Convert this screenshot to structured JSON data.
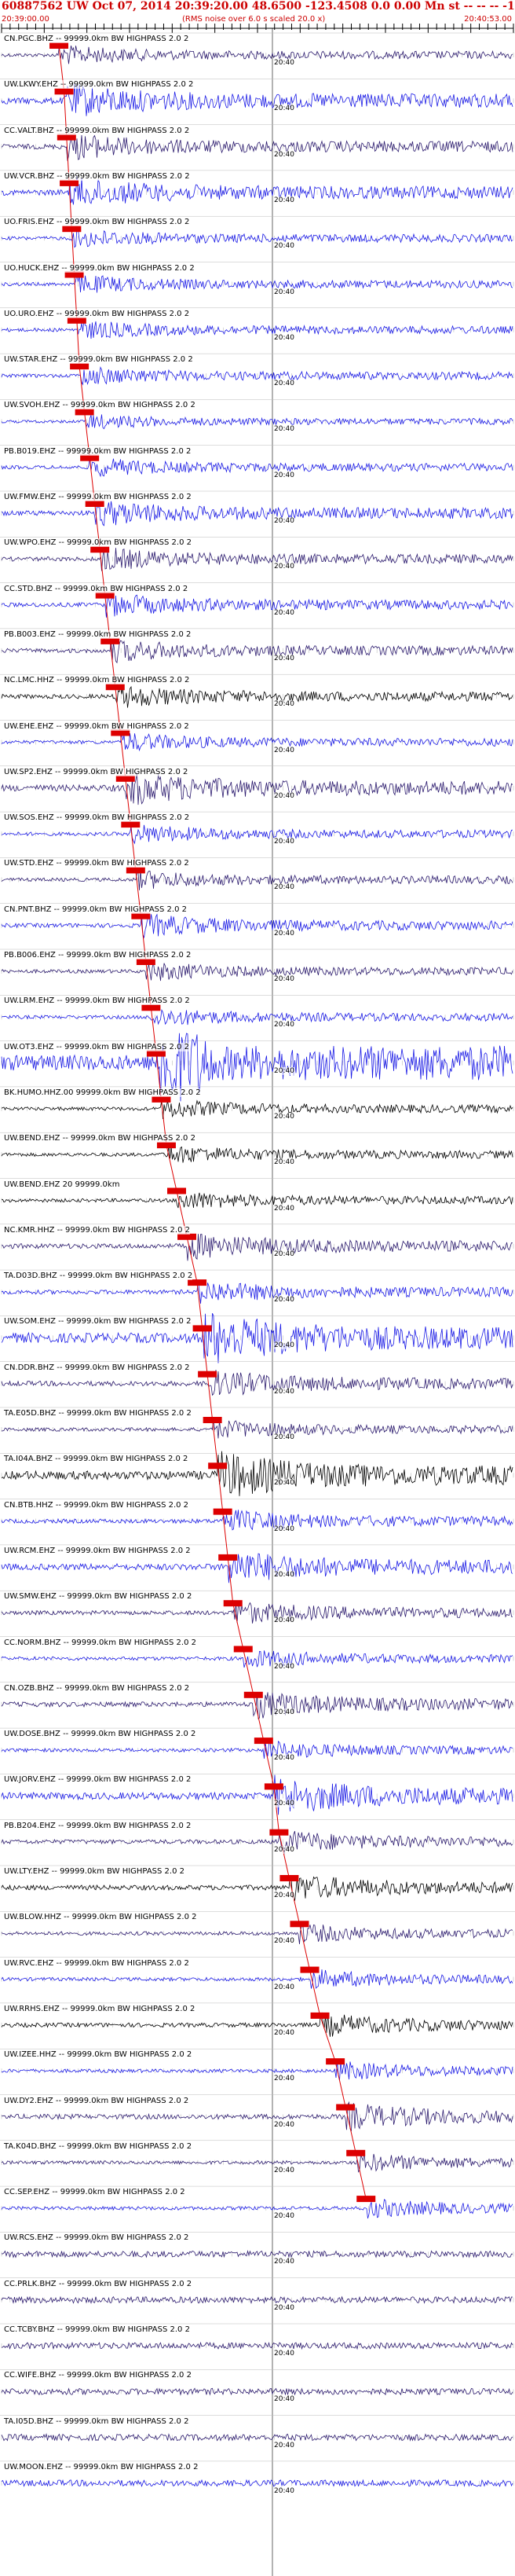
{
  "header": {
    "title": "60887562 UW Oct 07, 2014 20:39:20.00   48.6500 -123.4508  0.0 0.00 Mn st -- -- -- -1",
    "start_time": "20:39:00.00",
    "noise_note": "(RMS noise over 6.0 s scaled 20.0 x)",
    "end_time": "20:40:53.00"
  },
  "minute_mark": "20:40",
  "colors": {
    "header_text": "#cc0000",
    "pick_marker": "#dd0000",
    "trace_colors": [
      "#1a1ae6",
      "#2b1a6e",
      "#000000"
    ]
  },
  "traces": [
    {
      "label": "CN.PGC.BHZ -- 99999.0km BW  HIGHPASS  2.0  2",
      "color": "#2b1a6e",
      "amp": 5,
      "pick": 0.02
    },
    {
      "label": "UW.LKWY.EHZ -- 99999.0km BW  HIGHPASS  2.0  2",
      "color": "#1a1ae6",
      "amp": 9,
      "pick": 0.03
    },
    {
      "label": "CC.VALT.BHZ -- 99999.0km BW  HIGHPASS  2.0  2",
      "color": "#2b1a6e",
      "amp": 7,
      "pick": 0.035
    },
    {
      "label": "UW.VCR.BHZ -- 99999.0km BW  HIGHPASS  2.0  2",
      "color": "#1a1ae6",
      "amp": 8,
      "pick": 0.04
    },
    {
      "label": "UO.FRIS.EHZ -- 99999.0km BW  HIGHPASS  2.0  2",
      "color": "#1a1ae6",
      "amp": 5,
      "pick": 0.045
    },
    {
      "label": "UO.HUCK.EHZ -- 99999.0km BW  HIGHPASS  2.0  2",
      "color": "#1a1ae6",
      "amp": 5,
      "pick": 0.05
    },
    {
      "label": "UO.URO.EHZ -- 99999.0km BW  HIGHPASS  2.0  2",
      "color": "#1a1ae6",
      "amp": 5,
      "pick": 0.055
    },
    {
      "label": "UW.STAR.EHZ -- 99999.0km BW  HIGHPASS  2.0  2",
      "color": "#1a1ae6",
      "amp": 5,
      "pick": 0.06
    },
    {
      "label": "UW.SVOH.EHZ -- 99999.0km BW  HIGHPASS  2.0  2",
      "color": "#1a1ae6",
      "amp": 4,
      "pick": 0.07
    },
    {
      "label": "PB.B019.EHZ -- 99999.0km BW  HIGHPASS  2.0  2",
      "color": "#1a1ae6",
      "amp": 5,
      "pick": 0.08
    },
    {
      "label": "UW.FMW.EHZ -- 99999.0km BW  HIGHPASS  2.0  2",
      "color": "#1a1ae6",
      "amp": 7,
      "pick": 0.09
    },
    {
      "label": "UW.WPO.EHZ -- 99999.0km BW  HIGHPASS  2.0  2",
      "color": "#2b1a6e",
      "amp": 6,
      "pick": 0.1
    },
    {
      "label": "CC.STD.BHZ -- 99999.0km BW  HIGHPASS  2.0  2",
      "color": "#1a1ae6",
      "amp": 6,
      "pick": 0.11
    },
    {
      "label": "PB.B003.EHZ -- 99999.0km BW  HIGHPASS  2.0  2",
      "color": "#2b1a6e",
      "amp": 6,
      "pick": 0.12
    },
    {
      "label": "NC.LMC.HHZ -- 99999.0km BW  HIGHPASS  2.0  2",
      "color": "#000000",
      "amp": 6,
      "pick": 0.13
    },
    {
      "label": "UW.EHE.EHZ -- 99999.0km BW  HIGHPASS  2.0  2",
      "color": "#1a1ae6",
      "amp": 5,
      "pick": 0.14
    },
    {
      "label": "UW.SP2.EHZ -- 99999.0km BW  HIGHPASS  2.0  2",
      "color": "#2b1a6e",
      "amp": 9,
      "pick": 0.15
    },
    {
      "label": "UW.SOS.EHZ -- 99999.0km BW  HIGHPASS  2.0  2",
      "color": "#1a1ae6",
      "amp": 5,
      "pick": 0.16
    },
    {
      "label": "UW.STD.EHZ -- 99999.0km BW  HIGHPASS  2.0  2",
      "color": "#2b1a6e",
      "amp": 5,
      "pick": 0.17
    },
    {
      "label": "CN.PNT.BHZ -- 99999.0km BW  HIGHPASS  2.0  2",
      "color": "#1a1ae6",
      "amp": 6,
      "pick": 0.18
    },
    {
      "label": "PB.B006.EHZ -- 99999.0km BW  HIGHPASS  2.0  2",
      "color": "#2b1a6e",
      "amp": 5,
      "pick": 0.19
    },
    {
      "label": "UW.LRM.EHZ -- 99999.0km BW  HIGHPASS  2.0  2",
      "color": "#1a1ae6",
      "amp": 5,
      "pick": 0.2
    },
    {
      "label": "UW.OT3.EHZ -- 99999.0km BW  HIGHPASS  2.0  2",
      "color": "#1a1ae6",
      "amp": 22,
      "pick": 0.21
    },
    {
      "label": "BK.HUMO.HHZ.00 99999.0km BW  HIGHPASS  2.0  2",
      "color": "#000000",
      "amp": 5,
      "pick": 0.22
    },
    {
      "label": "UW.BEND.EHZ -- 99999.0km BW  HIGHPASS  2.0  2",
      "color": "#000000",
      "amp": 5,
      "pick": 0.23
    },
    {
      "label": "UW.BEND.EHZ 20 99999.0km",
      "color": "#000000",
      "amp": 5,
      "pick": 0.25
    },
    {
      "label": "NC.KMR.HHZ -- 99999.0km BW  HIGHPASS  2.0  2",
      "color": "#2b1a6e",
      "amp": 7,
      "pick": 0.27
    },
    {
      "label": "TA.D03D.BHZ -- 99999.0km BW  HIGHPASS  2.0  2",
      "color": "#1a1ae6",
      "amp": 6,
      "pick": 0.29
    },
    {
      "label": "UW.SOM.EHZ -- 99999.0km BW  HIGHPASS  2.0  2",
      "color": "#1a1ae6",
      "amp": 14,
      "pick": 0.3
    },
    {
      "label": "CN.DDR.BHZ -- 99999.0km BW  HIGHPASS  2.0  2",
      "color": "#2b1a6e",
      "amp": 7,
      "pick": 0.31
    },
    {
      "label": "TA.E05D.BHZ -- 99999.0km BW  HIGHPASS  2.0  2",
      "color": "#2b1a6e",
      "amp": 5,
      "pick": 0.32
    },
    {
      "label": "TA.I04A.BHZ -- 99999.0km BW  HIGHPASS  2.0  2",
      "color": "#000000",
      "amp": 12,
      "pick": 0.33
    },
    {
      "label": "CN.BTB.HHZ -- 99999.0km BW  HIGHPASS  2.0  2",
      "color": "#1a1ae6",
      "amp": 6,
      "pick": 0.34
    },
    {
      "label": "UW.RCM.EHZ -- 99999.0km BW  HIGHPASS  2.0  2",
      "color": "#1a1ae6",
      "amp": 9,
      "pick": 0.35
    },
    {
      "label": "UW.SMW.EHZ -- 99999.0km BW  HIGHPASS  2.0  2",
      "color": "#2b1a6e",
      "amp": 6,
      "pick": 0.36
    },
    {
      "label": "CC.NORM.BHZ -- 99999.0km BW  HIGHPASS  2.0  2",
      "color": "#1a1ae6",
      "amp": 5,
      "pick": 0.38
    },
    {
      "label": "CN.OZB.BHZ -- 99999.0km BW  HIGHPASS  2.0  2",
      "color": "#2b1a6e",
      "amp": 7,
      "pick": 0.4
    },
    {
      "label": "UW.DOSE.BHZ -- 99999.0km BW  HIGHPASS  2.0  2",
      "color": "#1a1ae6",
      "amp": 5,
      "pick": 0.42
    },
    {
      "label": "UW.JORV.EHZ -- 99999.0km BW  HIGHPASS  2.0  2",
      "color": "#1a1ae6",
      "amp": 10,
      "pick": 0.44
    },
    {
      "label": "PB.B204.EHZ -- 99999.0km BW  HIGHPASS  2.0  2",
      "color": "#2b1a6e",
      "amp": 6,
      "pick": 0.45
    },
    {
      "label": "UW.LTY.EHZ -- 99999.0km BW  HIGHPASS  2.0  2",
      "color": "#000000",
      "amp": 7,
      "pick": 0.47
    },
    {
      "label": "UW.BLOW.HHZ -- 99999.0km BW  HIGHPASS  2.0  2",
      "color": "#2b1a6e",
      "amp": 5,
      "pick": 0.49
    },
    {
      "label": "UW.RVC.EHZ -- 99999.0km BW  HIGHPASS  2.0  2",
      "color": "#1a1ae6",
      "amp": 5,
      "pick": 0.51
    },
    {
      "label": "UW.RRHS.EHZ -- 99999.0km BW  HIGHPASS  2.0  2",
      "color": "#000000",
      "amp": 6,
      "pick": 0.53
    },
    {
      "label": "UW.IZEE.HHZ -- 99999.0km BW  HIGHPASS  2.0  2",
      "color": "#1a1ae6",
      "amp": 5,
      "pick": 0.56
    },
    {
      "label": "UW.DY2.EHZ -- 99999.0km BW  HIGHPASS  2.0  2",
      "color": "#2b1a6e",
      "amp": 7,
      "pick": 0.58
    },
    {
      "label": "TA.K04D.BHZ -- 99999.0km BW  HIGHPASS  2.0  2",
      "color": "#2b1a6e",
      "amp": 5,
      "pick": 0.6
    },
    {
      "label": "CC.SEP.EHZ -- 99999.0km BW  HIGHPASS  2.0  2",
      "color": "#1a1ae6",
      "amp": 5,
      "pick": 0.62
    },
    {
      "label": "UW.RCS.EHZ -- 99999.0km BW  HIGHPASS  2.0  2",
      "color": "#2b1a6e",
      "amp": 4,
      "pick": -1
    },
    {
      "label": "CC.PRLK.BHZ -- 99999.0km BW  HIGHPASS  2.0  2",
      "color": "#2b1a6e",
      "amp": 4,
      "pick": -1
    },
    {
      "label": "CC.TCBY.BHZ -- 99999.0km BW  HIGHPASS  2.0  2",
      "color": "#2b1a6e",
      "amp": 4,
      "pick": -1
    },
    {
      "label": "CC.WIFE.BHZ -- 99999.0km BW  HIGHPASS  2.0  2",
      "color": "#2b1a6e",
      "amp": 4,
      "pick": -1
    },
    {
      "label": "TA.I05D.BHZ -- 99999.0km BW  HIGHPASS  2.0  2",
      "color": "#2b1a6e",
      "amp": 4,
      "pick": -1
    },
    {
      "label": "UW.MOON.EHZ -- 99999.0km BW  HIGHPASS  2.0  2",
      "color": "#1a1ae6",
      "amp": 4,
      "pick": -1
    }
  ]
}
